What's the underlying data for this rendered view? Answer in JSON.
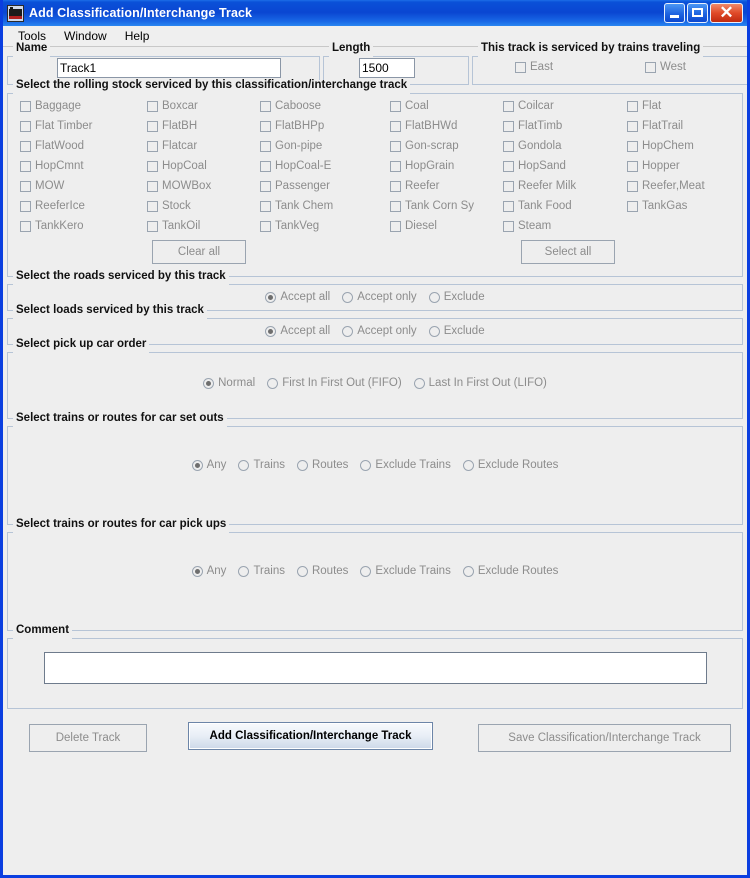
{
  "window": {
    "title": "Add Classification/Interchange Track",
    "icon": "locomotive-icon",
    "minimize_label": "",
    "maximize_label": "",
    "close_label": "✕",
    "accent_color": "#0a46d2",
    "background_color": "#eeeeee"
  },
  "menubar": {
    "items": [
      {
        "label": "Tools"
      },
      {
        "label": "Window"
      },
      {
        "label": "Help"
      }
    ]
  },
  "name_group": {
    "legend": "Name",
    "value": "Track1",
    "placeholder": ""
  },
  "length_group": {
    "legend": "Length",
    "value": "1500",
    "placeholder": ""
  },
  "direction_group": {
    "legend": "This track is serviced by trains traveling",
    "options": [
      {
        "label": "East",
        "checked": false
      },
      {
        "label": "West",
        "checked": false
      }
    ]
  },
  "rolling_stock": {
    "legend": "Select the rolling stock serviced by this classification/interchange track",
    "items": [
      {
        "label": "Baggage",
        "checked": false
      },
      {
        "label": "Boxcar",
        "checked": false
      },
      {
        "label": "Caboose",
        "checked": false
      },
      {
        "label": "Coal",
        "checked": false
      },
      {
        "label": "Coilcar",
        "checked": false
      },
      {
        "label": "Flat",
        "checked": false
      },
      {
        "label": "Flat Timber",
        "checked": false
      },
      {
        "label": "FlatBH",
        "checked": false
      },
      {
        "label": "FlatBHPp",
        "checked": false
      },
      {
        "label": "FlatBHWd",
        "checked": false
      },
      {
        "label": "FlatTimb",
        "checked": false
      },
      {
        "label": "FlatTrail",
        "checked": false
      },
      {
        "label": "FlatWood",
        "checked": false
      },
      {
        "label": "Flatcar",
        "checked": false
      },
      {
        "label": "Gon-pipe",
        "checked": false
      },
      {
        "label": "Gon-scrap",
        "checked": false
      },
      {
        "label": "Gondola",
        "checked": false
      },
      {
        "label": "HopChem",
        "checked": false
      },
      {
        "label": "HopCmnt",
        "checked": false
      },
      {
        "label": "HopCoal",
        "checked": false
      },
      {
        "label": "HopCoal-E",
        "checked": false
      },
      {
        "label": "HopGrain",
        "checked": false
      },
      {
        "label": "HopSand",
        "checked": false
      },
      {
        "label": "Hopper",
        "checked": false
      },
      {
        "label": "MOW",
        "checked": false
      },
      {
        "label": "MOWBox",
        "checked": false
      },
      {
        "label": "Passenger",
        "checked": false
      },
      {
        "label": "Reefer",
        "checked": false
      },
      {
        "label": "Reefer Milk",
        "checked": false
      },
      {
        "label": "Reefer,Meat",
        "checked": false
      },
      {
        "label": "ReeferIce",
        "checked": false
      },
      {
        "label": "Stock",
        "checked": false
      },
      {
        "label": "Tank Chem",
        "checked": false
      },
      {
        "label": "Tank Corn Sy",
        "checked": false
      },
      {
        "label": "Tank Food",
        "checked": false
      },
      {
        "label": "TankGas",
        "checked": false
      },
      {
        "label": "TankKero",
        "checked": false
      },
      {
        "label": "TankOil",
        "checked": false
      },
      {
        "label": "TankVeg",
        "checked": false
      },
      {
        "label": "Diesel",
        "checked": false
      },
      {
        "label": "Steam",
        "checked": false
      }
    ],
    "clear_all_label": "Clear all",
    "select_all_label": "Select all"
  },
  "roads_group": {
    "legend": "Select the roads serviced by this track",
    "options": [
      {
        "label": "Accept all",
        "selected": true
      },
      {
        "label": "Accept only",
        "selected": false
      },
      {
        "label": "Exclude",
        "selected": false
      }
    ]
  },
  "loads_group": {
    "legend": "Select loads serviced by this track",
    "options": [
      {
        "label": "Accept all",
        "selected": true
      },
      {
        "label": "Accept only",
        "selected": false
      },
      {
        "label": "Exclude",
        "selected": false
      }
    ]
  },
  "pickup_order_group": {
    "legend": "Select pick up car order",
    "options": [
      {
        "label": "Normal",
        "selected": true
      },
      {
        "label": "First In First Out (FIFO)",
        "selected": false
      },
      {
        "label": "Last In First Out (LIFO)",
        "selected": false
      }
    ]
  },
  "setouts_group": {
    "legend": "Select trains or routes for car set outs",
    "options": [
      {
        "label": "Any",
        "selected": true
      },
      {
        "label": "Trains",
        "selected": false
      },
      {
        "label": "Routes",
        "selected": false
      },
      {
        "label": "Exclude Trains",
        "selected": false
      },
      {
        "label": "Exclude Routes",
        "selected": false
      }
    ]
  },
  "pickups_group": {
    "legend": "Select trains or routes for car pick ups",
    "options": [
      {
        "label": "Any",
        "selected": true
      },
      {
        "label": "Trains",
        "selected": false
      },
      {
        "label": "Routes",
        "selected": false
      },
      {
        "label": "Exclude Trains",
        "selected": false
      },
      {
        "label": "Exclude Routes",
        "selected": false
      }
    ]
  },
  "comment_group": {
    "legend": "Comment",
    "value": "",
    "placeholder": ""
  },
  "footer": {
    "delete_label": "Delete Track",
    "add_label": "Add Classification/Interchange Track",
    "save_label": "Save Classification/Interchange Track"
  }
}
